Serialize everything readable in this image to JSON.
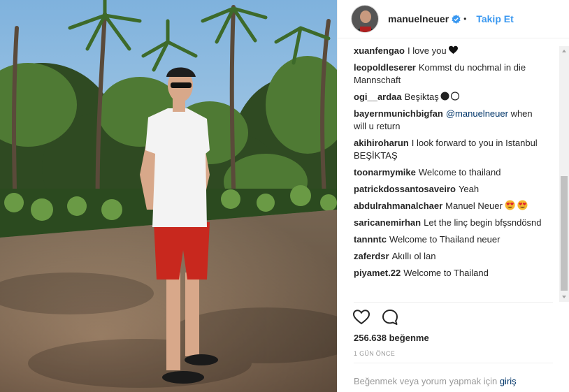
{
  "photo": {
    "alt_icon": "photo-image"
  },
  "header": {
    "username": "manuelneuer",
    "verified_icon": "verified-badge-icon",
    "separator": "•",
    "follow_label": "Takip Et"
  },
  "comments": [
    {
      "user": "xuanfengao",
      "text": "I love you",
      "emoji": "black-heart"
    },
    {
      "user": "leopoldleserer",
      "text": "Kommst du nochmal in die Mannschaft"
    },
    {
      "user": "ogi__ardaa",
      "text": "Beşiktaş",
      "emoji": "black-white-circles"
    },
    {
      "user": "bayernmunichbigfan",
      "mention": "@manuelneuer",
      "text": " when will u return"
    },
    {
      "user": "akihiroharun",
      "text": "I look forward to you in Istanbul BEŞİKTAŞ"
    },
    {
      "user": "toonarmymike",
      "text": "Welcome to thailand"
    },
    {
      "user": "patrickdossantosaveiro",
      "text": "Yeah"
    },
    {
      "user": "abdulrahmanalchaer",
      "text": "Manuel Neuer",
      "emoji": "heart-eyes"
    },
    {
      "user": "saricanemirhan",
      "text": "Let the linç begin bfşsndösnd"
    },
    {
      "user": "tannntc",
      "text": "Welcome to Thailand neuer"
    },
    {
      "user": "zaferdsr",
      "text": "Akıllı ol lan"
    },
    {
      "user": "piyamet.22",
      "text": "Welcome to Thailand"
    }
  ],
  "actions": {
    "like_icon": "heart-outline-icon",
    "comment_icon": "comment-bubble-icon"
  },
  "likes_text": "256.638 beğenme",
  "time_text": "1 GÜN ÖNCE",
  "login": {
    "prefix": "Beğenmek veya yorum yapmak için",
    "link": "giriş"
  },
  "colors": {
    "link_blue": "#3897f0",
    "mention": "#003569",
    "muted": "#999999"
  }
}
